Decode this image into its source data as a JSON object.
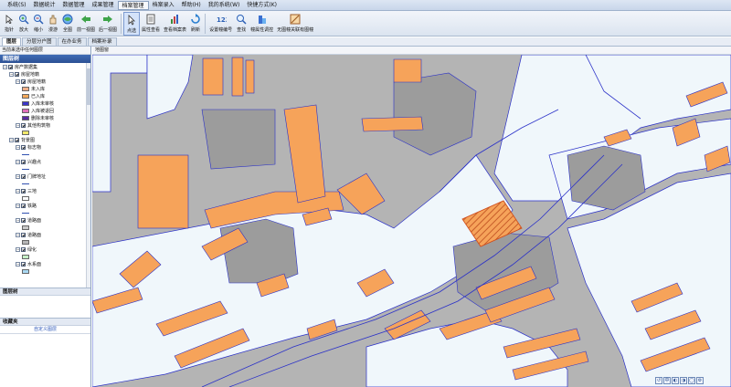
{
  "menu": [
    "系统(S)",
    "数据统计",
    "数据管理",
    "成果管理",
    "档案管理",
    "档案录入",
    "帮助(H)",
    "我的系统(W)",
    "快捷方式(K)"
  ],
  "menu_active_index": 4,
  "toolbar": {
    "tools": [
      {
        "label": "指针",
        "icon": "pointer-icon"
      },
      {
        "label": "放大",
        "icon": "zoom-in-icon"
      },
      {
        "label": "缩小",
        "icon": "zoom-out-icon"
      },
      {
        "label": "漫游",
        "icon": "pan-icon"
      },
      {
        "label": "全图",
        "icon": "full-extent-icon"
      },
      {
        "label": "前一视图",
        "icon": "back-view-icon"
      },
      {
        "label": "后一视图",
        "icon": "forward-view-icon"
      },
      {
        "label": "点选",
        "icon": "select-icon"
      },
      {
        "label": "属性查看",
        "icon": "attribute-icon"
      },
      {
        "label": "查看档案表",
        "icon": "archive-table-icon"
      },
      {
        "label": "刷新",
        "icon": "refresh-icon"
      },
      {
        "label": "设置幢编号",
        "icon": "building-number-icon"
      },
      {
        "label": "查找",
        "icon": "find-icon"
      },
      {
        "label": "幢属性调控",
        "icon": "building-attr-icon"
      },
      {
        "label": "无图幢关联有图幢",
        "icon": "link-building-icon"
      }
    ],
    "active_index": 7
  },
  "left_tabs": [
    "图层",
    "分层分户图",
    "在办业务",
    "档案补录"
  ],
  "left_tabs_active": 0,
  "left_caption": "当前来选中任何图层",
  "layer_tree_title": "图层树",
  "tree": [
    {
      "label": "房产数据集",
      "level": 0,
      "type": "group"
    },
    {
      "label": "房屋地籍",
      "level": 1,
      "type": "group"
    },
    {
      "label": "房屋地籍",
      "level": 2,
      "type": "group"
    },
    {
      "label": "未入库",
      "level": 3,
      "type": "swatch",
      "color": "#f2b08a"
    },
    {
      "label": "已入库",
      "level": 3,
      "type": "swatch",
      "color": "#f5a95a"
    },
    {
      "label": "入库未审核",
      "level": 3,
      "type": "swatch",
      "color": "#3a36c8"
    },
    {
      "label": "入库被退回",
      "level": 3,
      "type": "swatch",
      "color": "#e070b8"
    },
    {
      "label": "删除未审核",
      "level": 3,
      "type": "swatch",
      "color": "#5a2ba0"
    },
    {
      "label": "其他构筑物",
      "level": 2,
      "type": "group"
    },
    {
      "label": "",
      "level": 3,
      "type": "swatch",
      "color": "#f3e96a"
    },
    {
      "label": "背景图",
      "level": 1,
      "type": "group"
    },
    {
      "label": "标志物",
      "level": 2,
      "type": "group"
    },
    {
      "label": "",
      "level": 3,
      "type": "line"
    },
    {
      "label": "兴趣点",
      "level": 2,
      "type": "group"
    },
    {
      "label": "",
      "level": 3,
      "type": "line"
    },
    {
      "label": "门牌地址",
      "level": 2,
      "type": "group"
    },
    {
      "label": "",
      "level": 3,
      "type": "line"
    },
    {
      "label": "三地",
      "level": 2,
      "type": "group"
    },
    {
      "label": "",
      "level": 3,
      "type": "swatch",
      "color": "#ffffff"
    },
    {
      "label": "铁路",
      "level": 2,
      "type": "group"
    },
    {
      "label": "",
      "level": 3,
      "type": "line"
    },
    {
      "label": "道路面",
      "level": 2,
      "type": "group"
    },
    {
      "label": "",
      "level": 3,
      "type": "swatch",
      "color": "#c9c9c9"
    },
    {
      "label": "道路面",
      "level": 2,
      "type": "group"
    },
    {
      "label": "",
      "level": 3,
      "type": "swatch",
      "color": "#b6b6b6"
    },
    {
      "label": "绿化",
      "level": 2,
      "type": "group"
    },
    {
      "label": "",
      "level": 3,
      "type": "swatch",
      "color": "#c6f0c6"
    },
    {
      "label": "水系面",
      "level": 2,
      "type": "group"
    },
    {
      "label": "",
      "level": 3,
      "type": "swatch",
      "color": "#a9d8f2"
    }
  ],
  "legend_title": "图层树",
  "favorites_title": "收藏夹",
  "favorites_button": "自定义图层",
  "map_header": "地图窗",
  "map_controls": [
    "↺",
    "中",
    "◐",
    "◑",
    "◯",
    "⚙"
  ],
  "colors": {
    "building": "#f6a35a",
    "road": "#b4b4b4",
    "block": "#f0f7fb",
    "outline": "#2a30c8",
    "selected_stroke": "#d0501e"
  }
}
